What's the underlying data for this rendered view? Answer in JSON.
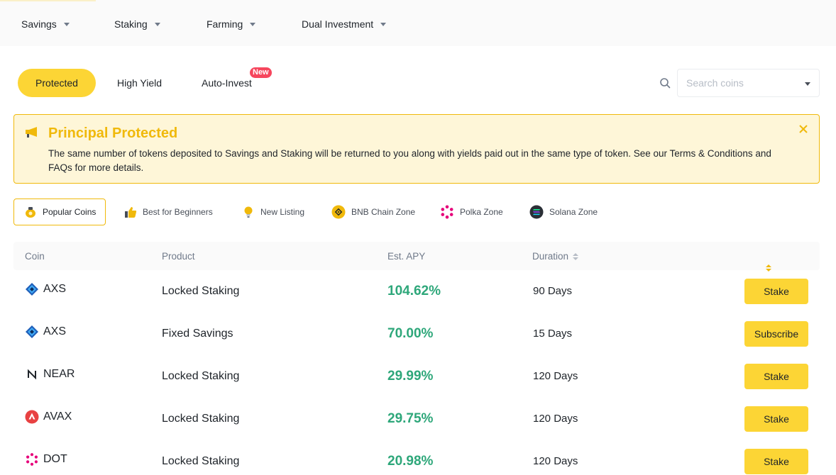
{
  "nav": {
    "items": [
      {
        "label": "Savings"
      },
      {
        "label": "Staking"
      },
      {
        "label": "Farming"
      },
      {
        "label": "Dual Investment"
      }
    ]
  },
  "tabs": {
    "protected": "Protected",
    "high_yield": "High Yield",
    "auto_invest": "Auto-Invest",
    "new_badge": "New"
  },
  "search": {
    "placeholder": "Search coins"
  },
  "banner": {
    "title": "Principal Protected",
    "text": "The same number of tokens deposited to Savings and Staking will be returned to you along with yields paid out in the same type of token. See our Terms & Conditions and FAQs for more details."
  },
  "zones": [
    {
      "label": "Popular Coins",
      "icon": "money-bag-icon"
    },
    {
      "label": "Best for Beginners",
      "icon": "thumbs-up-icon"
    },
    {
      "label": "New Listing",
      "icon": "lightbulb-icon"
    },
    {
      "label": "BNB Chain Zone",
      "icon": "bnb-icon"
    },
    {
      "label": "Polka Zone",
      "icon": "polkadot-icon"
    },
    {
      "label": "Solana Zone",
      "icon": "solana-icon"
    }
  ],
  "table": {
    "headers": {
      "coin": "Coin",
      "product": "Product",
      "apy": "Est. APY",
      "duration": "Duration"
    },
    "rows": [
      {
        "coin": "AXS",
        "icon": "axs-icon",
        "product": "Locked Staking",
        "apy": "104.62%",
        "duration": "90 Days",
        "action": "Stake"
      },
      {
        "coin": "AXS",
        "icon": "axs-icon",
        "product": "Fixed Savings",
        "apy": "70.00%",
        "duration": "15 Days",
        "action": "Subscribe"
      },
      {
        "coin": "NEAR",
        "icon": "near-icon",
        "product": "Locked Staking",
        "apy": "29.99%",
        "duration": "120 Days",
        "action": "Stake"
      },
      {
        "coin": "AVAX",
        "icon": "avax-icon",
        "product": "Locked Staking",
        "apy": "29.75%",
        "duration": "120 Days",
        "action": "Stake"
      },
      {
        "coin": "DOT",
        "icon": "dot-icon",
        "product": "Locked Staking",
        "apy": "20.98%",
        "duration": "120 Days",
        "action": "Stake"
      }
    ]
  },
  "colors": {
    "accent": "#fcd535",
    "banner_title": "#f0b90b",
    "apy_green": "#2ea77a"
  }
}
